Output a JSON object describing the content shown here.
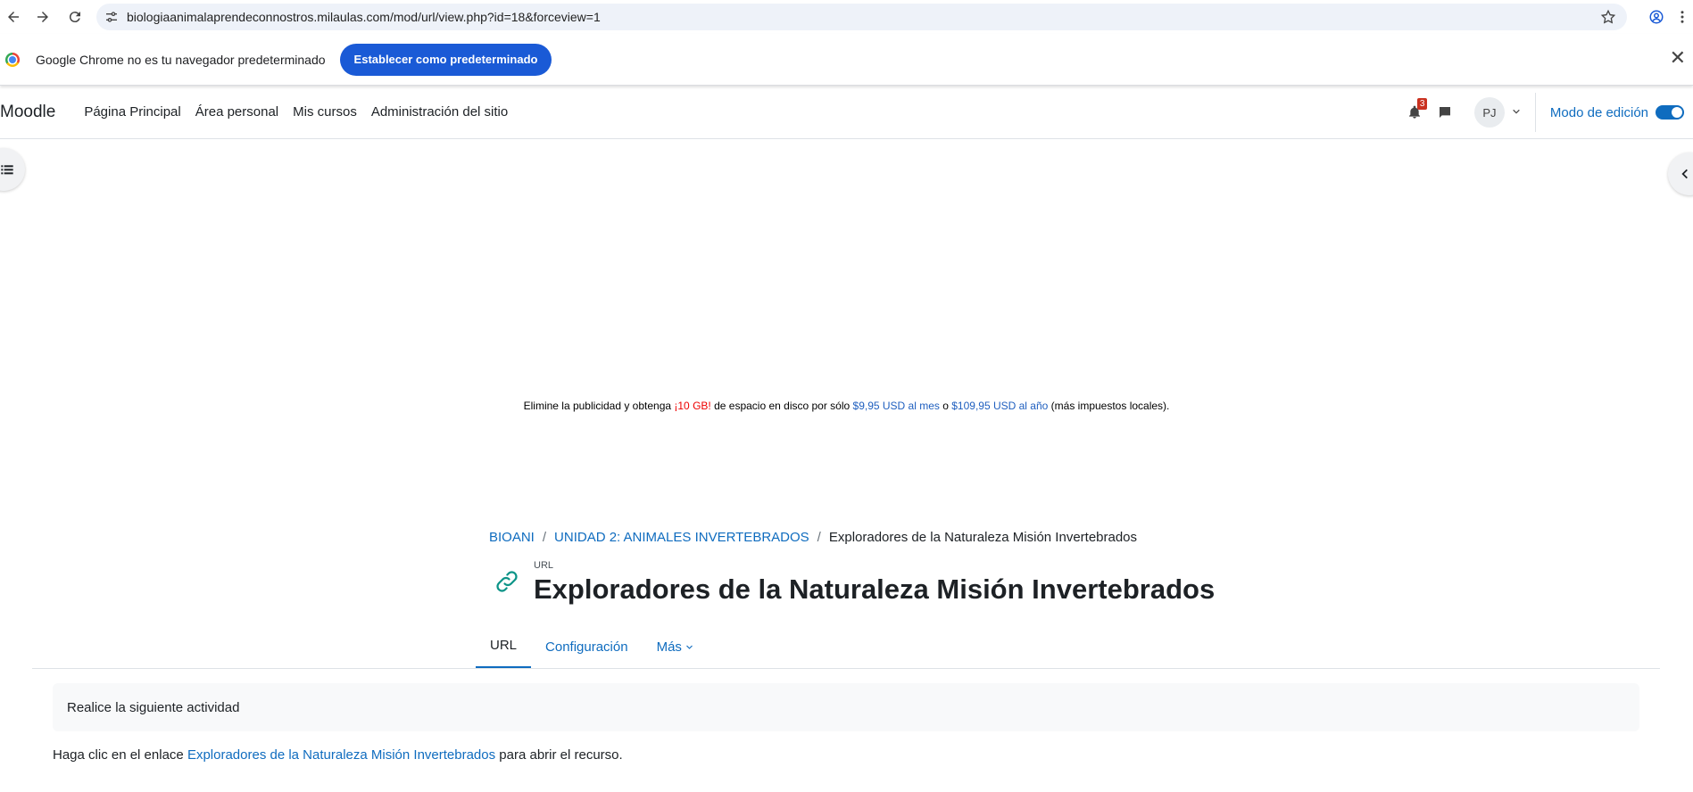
{
  "browser": {
    "url": "biologiaanimalaprendeconnostros.milaulas.com/mod/url/view.php?id=18&forceview=1",
    "infobar_message": "Google Chrome no es tu navegador predeterminado",
    "infobar_button": "Establecer como predeterminado"
  },
  "moodle": {
    "brand": "Moodle",
    "nav": [
      "Página Principal",
      "Área personal",
      "Mis cursos",
      "Administración del sitio"
    ],
    "notification_count": "3",
    "avatar_initials": "PJ",
    "edit_mode_label": "Modo de edición"
  },
  "ad": {
    "part1": "Elimine la publicidad y obtenga ",
    "highlight": "¡10 GB!",
    "part2": " de espacio en disco por sólo ",
    "price_month": "$9,95 USD al mes",
    "part3": " o ",
    "price_year": "$109,95 USD al año",
    "part4": " (más impuestos locales)."
  },
  "breadcrumb": {
    "course": "BIOANI",
    "section": "UNIDAD 2: ANIMALES INVERTEBRADOS",
    "current": "Exploradores de la Naturaleza Misión Invertebrados"
  },
  "header": {
    "module_type": "URL",
    "title": "Exploradores de la Naturaleza Misión Invertebrados"
  },
  "tabs": [
    "URL",
    "Configuración",
    "Más"
  ],
  "content": {
    "intro": "Realice la siguiente actividad",
    "click_prefix": "Haga clic en el enlace ",
    "click_link": "Exploradores de la Naturaleza Misión Invertebrados",
    "click_suffix": " para abrir el recurso."
  },
  "colors": {
    "accent": "#0f6cbf",
    "chrome_button": "#1a5ad6",
    "badge": "#ca3120"
  }
}
